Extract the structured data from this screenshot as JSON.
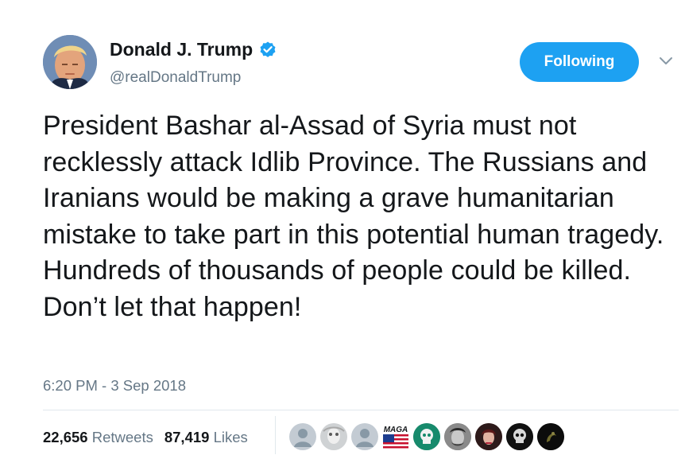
{
  "tweet": {
    "author": {
      "display_name": "Donald J. Trump",
      "handle": "@realDonaldTrump",
      "verified_icon": "verified-badge-icon"
    },
    "follow_button_label": "Following",
    "menu_icon": "chevron-down-icon",
    "text": "President Bashar al-Assad of Syria must not recklessly attack Idlib Province. The Russians and Iranians would be making a grave humanitarian mistake to take part in this potential human tragedy. Hundreds of thousands of people could be killed. Don’t let that happen!",
    "timestamp": "6:20 PM - 3 Sep 2018",
    "stats": {
      "retweets_count": "22,656",
      "retweets_label": "Retweets",
      "likes_count": "87,419",
      "likes_label": "Likes"
    },
    "likers": [
      {
        "icon": "default-avatar-icon"
      },
      {
        "icon": "photo-avatar-icon"
      },
      {
        "icon": "default-avatar-icon"
      },
      {
        "icon": "maga-flag-avatar-icon",
        "text": "MAGA"
      },
      {
        "icon": "skull-avatar-icon"
      },
      {
        "icon": "photo-avatar-icon"
      },
      {
        "icon": "photo-avatar-icon"
      },
      {
        "icon": "skull-avatar-icon"
      },
      {
        "icon": "photo-avatar-icon"
      }
    ],
    "colors": {
      "accent": "#1da1f2",
      "text": "#14171a",
      "secondary": "#657786",
      "divider": "#e1e8ed"
    }
  }
}
